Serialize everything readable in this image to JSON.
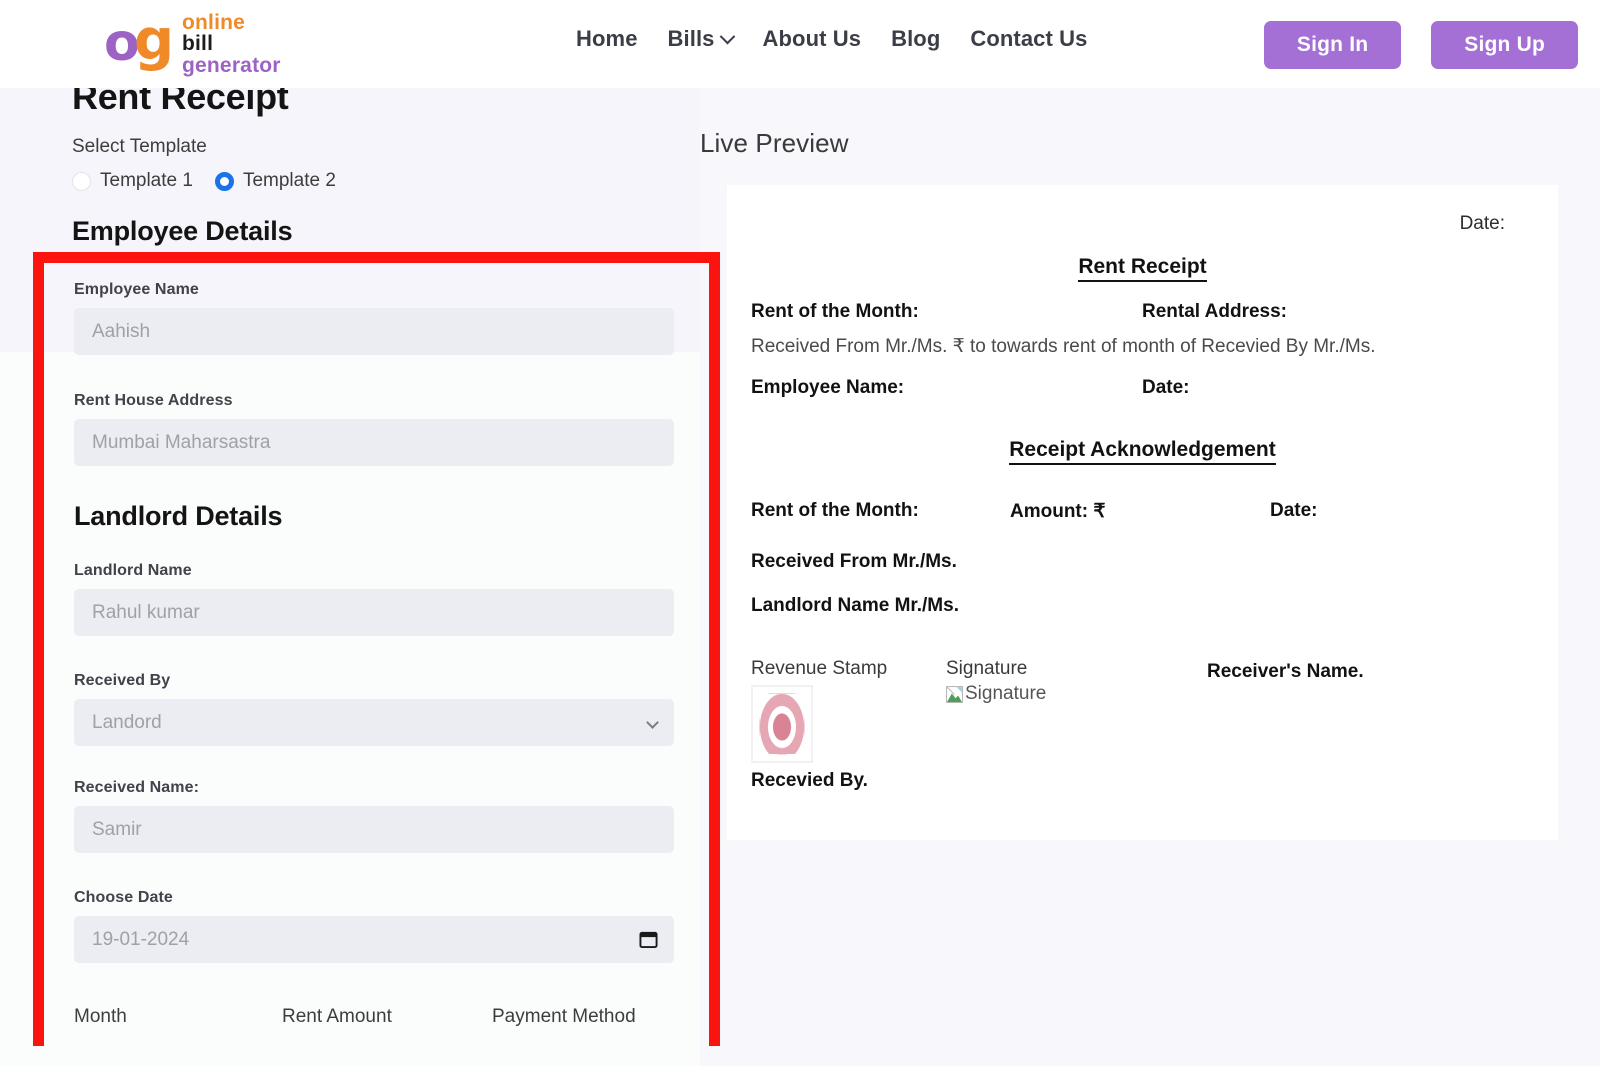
{
  "header": {
    "logo": {
      "mark_o": "o",
      "mark_g": "g",
      "line1": "online",
      "line2": "bill",
      "line3": "generator"
    },
    "nav": [
      {
        "label": "Home",
        "has_chevron": false
      },
      {
        "label": "Bills",
        "has_chevron": true
      },
      {
        "label": "About Us",
        "has_chevron": false
      },
      {
        "label": "Blog",
        "has_chevron": false
      },
      {
        "label": "Contact Us",
        "has_chevron": false
      }
    ],
    "sign_in": "Sign In",
    "sign_up": "Sign Up",
    "accent_color": "#a470d6"
  },
  "form": {
    "page_title": "Rent Receipt",
    "select_template_label": "Select Template",
    "templates": [
      {
        "label": "Template 1",
        "selected": false
      },
      {
        "label": "Template 2",
        "selected": true
      }
    ],
    "radio_selected_color": "#1a73e8",
    "employee_section_heading": "Employee Details",
    "landlord_section_heading": "Landlord Details",
    "fields": [
      {
        "label": "Employee Name",
        "placeholder": "Aahish",
        "value": "",
        "type": "text"
      },
      {
        "label": "Rent House Address",
        "placeholder": "Mumbai Maharsastra",
        "value": "",
        "type": "text"
      },
      {
        "label": "Landlord Name",
        "placeholder": "Rahul kumar",
        "value": "",
        "type": "text"
      },
      {
        "label": "Received By",
        "placeholder": "Landord",
        "value": "Landord",
        "type": "select"
      },
      {
        "label": "Received Name:",
        "placeholder": "Samir",
        "value": "",
        "type": "text"
      },
      {
        "label": "Choose Date",
        "placeholder": "19-01-2024",
        "value": "19-01-2024",
        "type": "date"
      }
    ],
    "column_headers": [
      "Month",
      "Rent Amount",
      "Payment Method"
    ]
  },
  "annotation": {
    "color": "#fa130f"
  },
  "preview": {
    "title": "Live Preview",
    "date_top": "Date:",
    "receipt_heading": "Rent Receipt",
    "rent_of_month": "Rent of the Month:",
    "rental_address": "Rental Address:",
    "sentence": "Received From Mr./Ms. ₹ to towards rent of month of Recevied By Mr./Ms.",
    "employee_name": "Employee Name:",
    "date_mid": "Date:",
    "ack_heading": "Receipt Acknowledgement",
    "ack_rent_of_month": "Rent of the Month:",
    "ack_amount": "Amount: ₹",
    "ack_date": "Date:",
    "received_from": "Received From Mr./Ms.",
    "landlord_name": "Landlord Name Mr./Ms.",
    "revenue_stamp_label": "Revenue Stamp",
    "signature_label": "Signature",
    "signature_alt": "Signature",
    "receivers_name": "Receiver's Name.",
    "received_by": "Recevied By."
  }
}
